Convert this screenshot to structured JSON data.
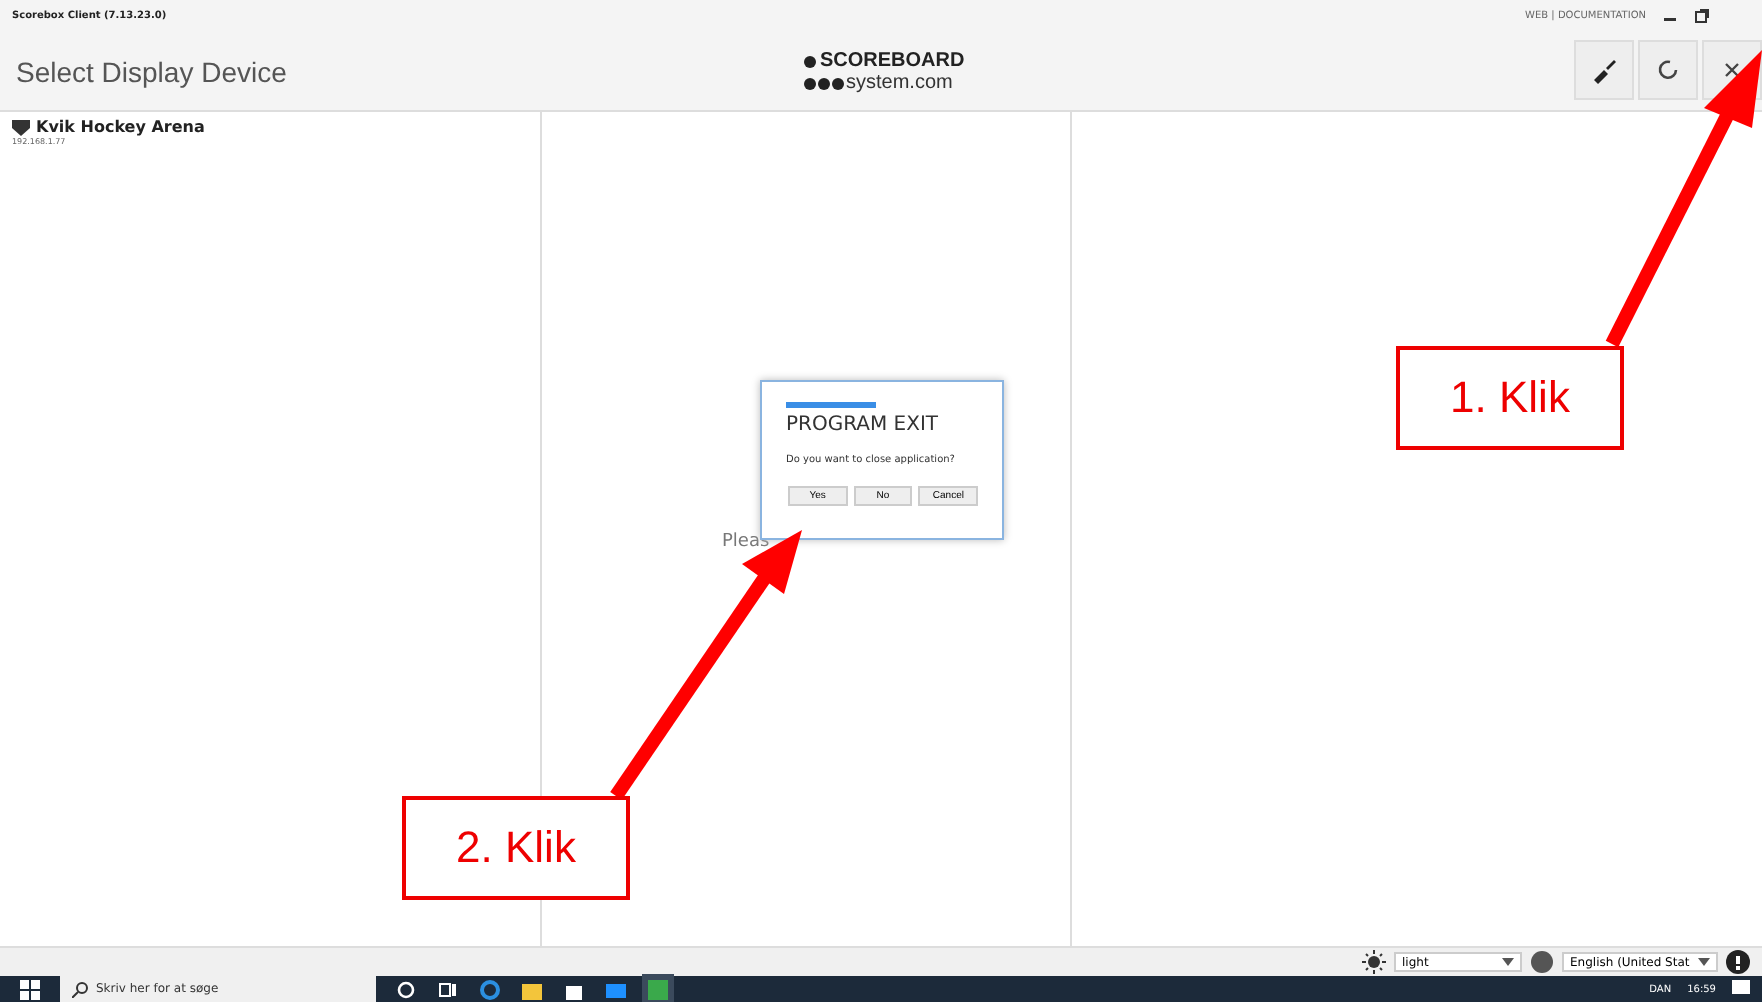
{
  "window": {
    "title": "Scorebox Client (7.13.23.0)",
    "links": "WEB | DOCUMENTATION"
  },
  "header": {
    "title": "Select Display Device",
    "logo_top": "SCOREBOARD",
    "logo_bottom": "system.com"
  },
  "devices": [
    {
      "name": "Kvik Hockey Arena",
      "address": "192.168.1.77"
    }
  ],
  "center_text": "Pleas",
  "dialog": {
    "title": "PROGRAM EXIT",
    "message": "Do you want to close application?",
    "buttons": [
      "Yes",
      "No",
      "Cancel"
    ]
  },
  "annotations": [
    {
      "label": "1. Klik"
    },
    {
      "label": "2. Klik"
    }
  ],
  "bottom_bar": {
    "theme": "light",
    "language": "English (United Stat"
  },
  "taskbar": {
    "search_placeholder": "Skriv her for at søge",
    "language": "DAN",
    "time": "16:59"
  }
}
